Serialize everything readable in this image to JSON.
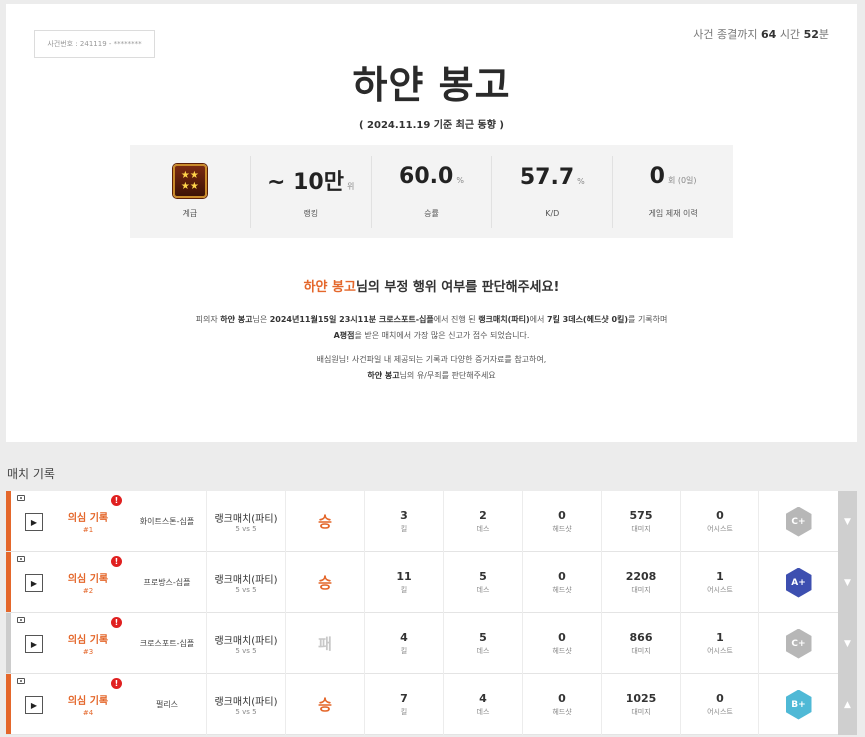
{
  "header": {
    "case_no": "사건번호 : 241119 - ********",
    "timer_prefix": "사건 종결까지",
    "timer_hours": "64",
    "timer_hours_unit": "시간",
    "timer_minutes": "52",
    "timer_minutes_unit": "분",
    "title": "하얀 봉고",
    "subtitle": "( 2024.11.19 기준 최근 동향 )"
  },
  "stats": {
    "rank_badge_glyph": "★★\n★★",
    "rank_label": "계급",
    "ranking_value": "~ 10만",
    "ranking_unit": "위",
    "ranking_label": "랭킹",
    "win_value": "60.0",
    "win_unit": "%",
    "win_label": "승률",
    "kd_value": "57.7",
    "kd_unit": "%",
    "kd_label": "K/D",
    "ban_value": "0",
    "ban_unit": "회 (0일)",
    "ban_label": "게임 제재 이력"
  },
  "judge": {
    "name": "하얀 봉고",
    "heading_rest": "님의 부정 행위 여부를 판단해주세요!",
    "line1_a": "피의자 ",
    "line1_name": "하얀 봉고",
    "line1_b": "님은 ",
    "line1_date": "2024년11월15일 23시11분 크로스포트-십플",
    "line1_c": "에서 진행 된 ",
    "line1_mode": "랭크매치(파티)",
    "line1_d": "에서 ",
    "line1_kd": "7킬 3데스(헤드샷 0킬)",
    "line1_e": "를 기록하며",
    "line2_grade": "A평점",
    "line2_rest": "을 받은 매치에서 가장 많은 신고가 접수 되었습니다.",
    "line3": "배심원님! 사건파일 내 제공되는 기록과 다양한 증거자료를 참고하여,",
    "line4_name": "하얀 봉고",
    "line4_rest": "님의 유/무죄를 판단해주세요"
  },
  "section_title": "매치 기록",
  "labels": {
    "suspicion": "의심 기록",
    "kill": "킬",
    "death": "데스",
    "headshot": "헤드샷",
    "damage": "대미지",
    "assist": "어시스트"
  },
  "colors": {
    "accent": "#e4672b",
    "win_bar": "#e4672b",
    "lose_bar": "#cccccc",
    "lose_text": "#c8c8c8",
    "grade_c": "#b7b7b7",
    "grade_a": "#3d4fb0",
    "grade_b": "#4fb9d6"
  },
  "matches": [
    {
      "no": "#1",
      "map": "화이트스톤-십플",
      "mode": "랭크매치(파티)",
      "sub": "5 vs 5",
      "result": "승",
      "kill": "3",
      "death": "2",
      "headshot": "0",
      "damage": "575",
      "assist": "0",
      "grade": "C+",
      "toggle": "▼"
    },
    {
      "no": "#2",
      "map": "프로방스-십플",
      "mode": "랭크매치(파티)",
      "sub": "5 vs 5",
      "result": "승",
      "kill": "11",
      "death": "5",
      "headshot": "0",
      "damage": "2208",
      "assist": "1",
      "grade": "A+",
      "toggle": "▼"
    },
    {
      "no": "#3",
      "map": "크로스포트-십플",
      "mode": "랭크매치(파티)",
      "sub": "5 vs 5",
      "result": "패",
      "kill": "4",
      "death": "5",
      "headshot": "0",
      "damage": "866",
      "assist": "1",
      "grade": "C+",
      "toggle": "▼"
    },
    {
      "no": "#4",
      "map": "펄리스",
      "mode": "랭크매치(파티)",
      "sub": "5 vs 5",
      "result": "승",
      "kill": "7",
      "death": "4",
      "headshot": "0",
      "damage": "1025",
      "assist": "0",
      "grade": "B+",
      "toggle": "▲"
    }
  ]
}
